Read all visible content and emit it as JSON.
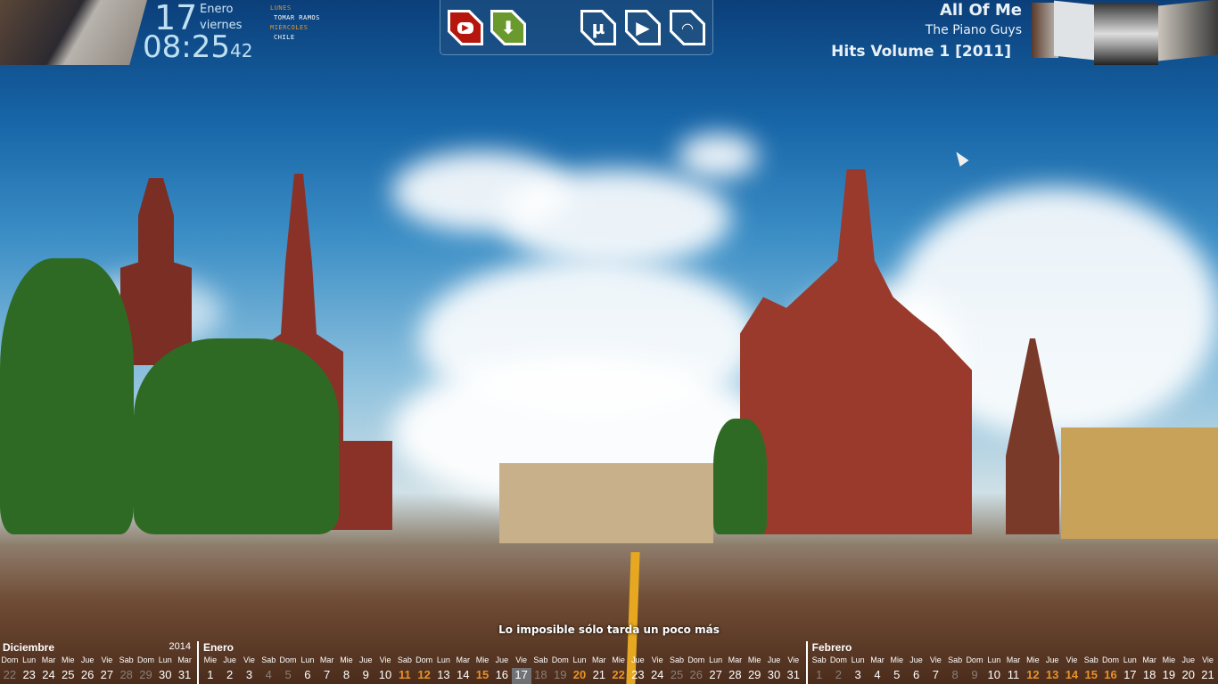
{
  "clock": {
    "day": "17",
    "month": "Enero",
    "weekday": "viernes",
    "time": "08:25",
    "seconds": "42"
  },
  "events": [
    {
      "day": "LUNES",
      "item": "TOMAR RAMOS"
    },
    {
      "day": "MIÉRCOLES",
      "item": "CHILE"
    }
  ],
  "dock": {
    "icons": [
      "youtube-icon",
      "download-icon",
      "utorrent-icon",
      "play-icon",
      "wifi-icon"
    ]
  },
  "now_playing": {
    "title": "All Of Me",
    "artist": "The Piano Guys",
    "album": "Hits Volume 1 [2011]"
  },
  "quote": "Lo imposible sólo tarda un poco más",
  "colors": {
    "holiday": "#e8922a",
    "dim": "#8b7f78",
    "dock_bg": "#1e5082"
  },
  "calendar": [
    {
      "name": "Diciembre",
      "year": "2014",
      "days": [
        [
          "Dom",
          "22",
          "dim"
        ],
        [
          "Lun",
          "23",
          ""
        ],
        [
          "Mar",
          "24",
          ""
        ],
        [
          "Mie",
          "25",
          ""
        ],
        [
          "Jue",
          "26",
          ""
        ],
        [
          "Vie",
          "27",
          ""
        ],
        [
          "Sab",
          "28",
          "dim"
        ],
        [
          "Dom",
          "29",
          "dim"
        ],
        [
          "Lun",
          "30",
          ""
        ],
        [
          "Mar",
          "31",
          ""
        ]
      ]
    },
    {
      "name": "Enero",
      "year": "",
      "days": [
        [
          "Mie",
          "1",
          ""
        ],
        [
          "Jue",
          "2",
          ""
        ],
        [
          "Vie",
          "3",
          ""
        ],
        [
          "Sab",
          "4",
          "dim"
        ],
        [
          "Dom",
          "5",
          "dim"
        ],
        [
          "Lun",
          "6",
          ""
        ],
        [
          "Mar",
          "7",
          ""
        ],
        [
          "Mie",
          "8",
          ""
        ],
        [
          "Jue",
          "9",
          ""
        ],
        [
          "Vie",
          "10",
          ""
        ],
        [
          "Sab",
          "11",
          "hol"
        ],
        [
          "Dom",
          "12",
          "hol"
        ],
        [
          "Lun",
          "13",
          ""
        ],
        [
          "Mar",
          "14",
          ""
        ],
        [
          "Mie",
          "15",
          "hol"
        ],
        [
          "Jue",
          "16",
          ""
        ],
        [
          "Vie",
          "17",
          "today"
        ],
        [
          "Sab",
          "18",
          "dim"
        ],
        [
          "Dom",
          "19",
          "dim"
        ],
        [
          "Lun",
          "20",
          "hol"
        ],
        [
          "Mar",
          "21",
          ""
        ],
        [
          "Mie",
          "22",
          "hol"
        ],
        [
          "Jue",
          "23",
          ""
        ],
        [
          "Vie",
          "24",
          ""
        ],
        [
          "Sab",
          "25",
          "dim"
        ],
        [
          "Dom",
          "26",
          "dim"
        ],
        [
          "Lun",
          "27",
          ""
        ],
        [
          "Mar",
          "28",
          ""
        ],
        [
          "Mie",
          "29",
          ""
        ],
        [
          "Jue",
          "30",
          ""
        ],
        [
          "Vie",
          "31",
          ""
        ]
      ]
    },
    {
      "name": "Febrero",
      "year": "",
      "days": [
        [
          "Sab",
          "1",
          "dim"
        ],
        [
          "Dom",
          "2",
          "dim"
        ],
        [
          "Lun",
          "3",
          ""
        ],
        [
          "Mar",
          "4",
          ""
        ],
        [
          "Mie",
          "5",
          ""
        ],
        [
          "Jue",
          "6",
          ""
        ],
        [
          "Vie",
          "7",
          ""
        ],
        [
          "Sab",
          "8",
          "dim"
        ],
        [
          "Dom",
          "9",
          "dim"
        ],
        [
          "Lun",
          "10",
          ""
        ],
        [
          "Mar",
          "11",
          ""
        ],
        [
          "Mie",
          "12",
          "hol"
        ],
        [
          "Jue",
          "13",
          "hol"
        ],
        [
          "Vie",
          "14",
          "hol"
        ],
        [
          "Sab",
          "15",
          "hol"
        ],
        [
          "Dom",
          "16",
          "hol"
        ],
        [
          "Lun",
          "17",
          ""
        ],
        [
          "Mar",
          "18",
          ""
        ],
        [
          "Mie",
          "19",
          ""
        ],
        [
          "Jue",
          "20",
          ""
        ],
        [
          "Vie",
          "21",
          ""
        ]
      ]
    }
  ]
}
